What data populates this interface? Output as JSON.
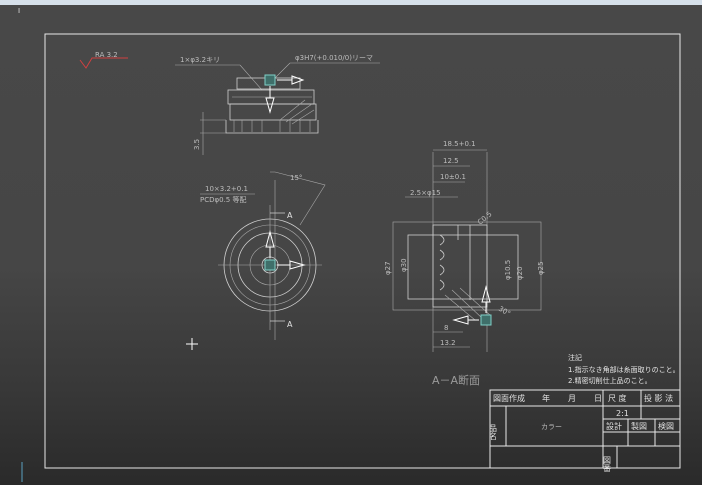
{
  "app": {
    "cursor_glyph": "I"
  },
  "drawing": {
    "roughness": "RA 3.2",
    "top_view": {
      "hole_note": "1×φ3.2キリ",
      "ream_note": "φ3H7(+0.010/0)リーマ",
      "height_dim": "3.5"
    },
    "front_view": {
      "slot_note": "10×3.2+0.1",
      "slot_sub": "PCDφ0.5 等配",
      "angle": "15°",
      "section_mark_top": "A",
      "section_mark_bottom": "A"
    },
    "section_view": {
      "title": "A－A断面",
      "dims": [
        "18.5+0.1",
        "12.5",
        "10±0.1",
        "2.5×φ15",
        "C0.5",
        "φ27",
        "φ30",
        "φ10.5",
        "φ20",
        "φ25",
        "8",
        "13.2",
        "30°"
      ]
    },
    "notes": {
      "heading": "注記",
      "items": [
        "1.指示なき角部は糸面取りのこと。",
        "2.精密切削仕上品のこと。"
      ]
    },
    "title_block": {
      "created_label": "図面作成",
      "year": "年",
      "month": "月",
      "day": "日",
      "scale_label": "尺 度",
      "scale_value": "2:1",
      "projection_label": "投 影 法",
      "part_name_label": "品名",
      "part_name": "カラー",
      "design_label": "設計",
      "drafting_label": "製図",
      "check_label": "検図",
      "drawing_no_label": "図番"
    }
  }
}
